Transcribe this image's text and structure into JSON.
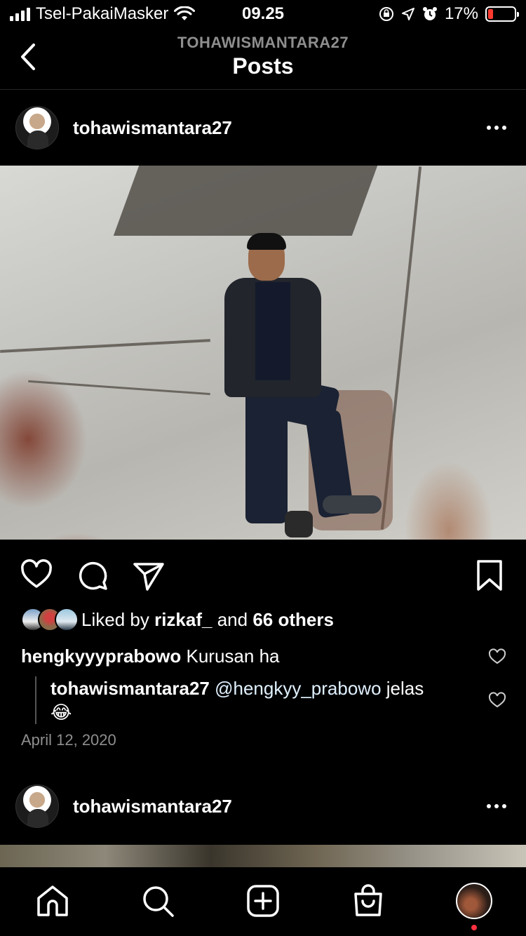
{
  "status_bar": {
    "carrier": "Tsel-PakaiMasker",
    "time": "09.25",
    "battery": "17%",
    "battery_level": 0.17
  },
  "header": {
    "subtitle": "TOHAWISMANTARA27",
    "title": "Posts"
  },
  "post1": {
    "username": "tohawismantara27",
    "liked_by_prefix": "Liked by ",
    "liked_by_user": "rizkaf_",
    "liked_by_and": " and ",
    "liked_by_others": "66 others",
    "comments": [
      {
        "user": "hengkyyyprabowo",
        "text": " Kurusan ha"
      }
    ],
    "reply": {
      "user": "tohawismantara27",
      "mention": " @hengkyy_prabowo",
      "text": " jelas",
      "emoji": "😂"
    },
    "date": "April 12, 2020"
  },
  "post2": {
    "username": "tohawismantara27"
  },
  "colors": {
    "background": "#000000",
    "muted": "#8e8e8e",
    "battery_low": "#ff3b30",
    "notification": "#ff3040"
  },
  "icons": [
    "back-icon",
    "more-icon",
    "heart-icon",
    "comment-icon",
    "share-icon",
    "bookmark-icon",
    "home-icon",
    "search-icon",
    "new-post-icon",
    "shop-icon",
    "profile-avatar"
  ]
}
